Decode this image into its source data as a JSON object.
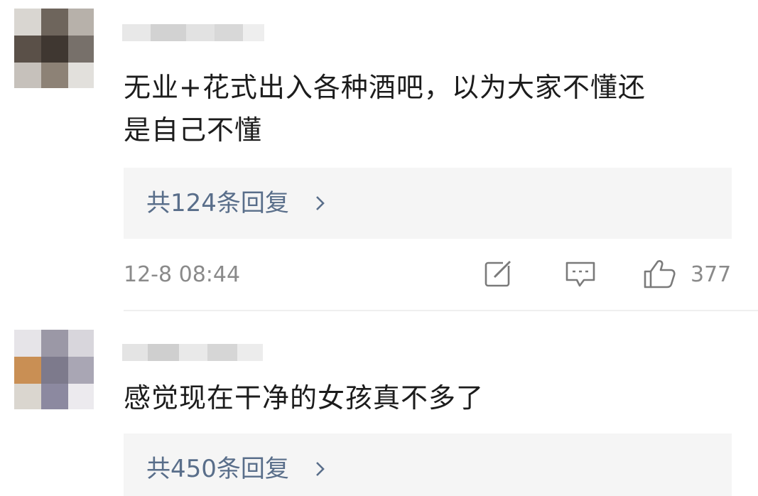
{
  "comments": [
    {
      "text_line1": "无业+花式出入各种酒吧，以为大家不懂还",
      "text_line2": "是自己不懂",
      "replies_label": "共124条回复",
      "timestamp": "12-8 08:44",
      "likes": "377",
      "icons": [
        "edit-icon",
        "comment-icon",
        "thumbs-up-icon",
        "chevron-right-icon"
      ]
    },
    {
      "text_line1": "感觉现在干净的女孩真不多了",
      "replies_label": "共450条回复",
      "icons": [
        "chevron-right-icon"
      ]
    }
  ],
  "colors": {
    "reply_link": "#596e8a",
    "reply_bg": "#f5f5f5",
    "meta_text": "#8a8a8a"
  }
}
